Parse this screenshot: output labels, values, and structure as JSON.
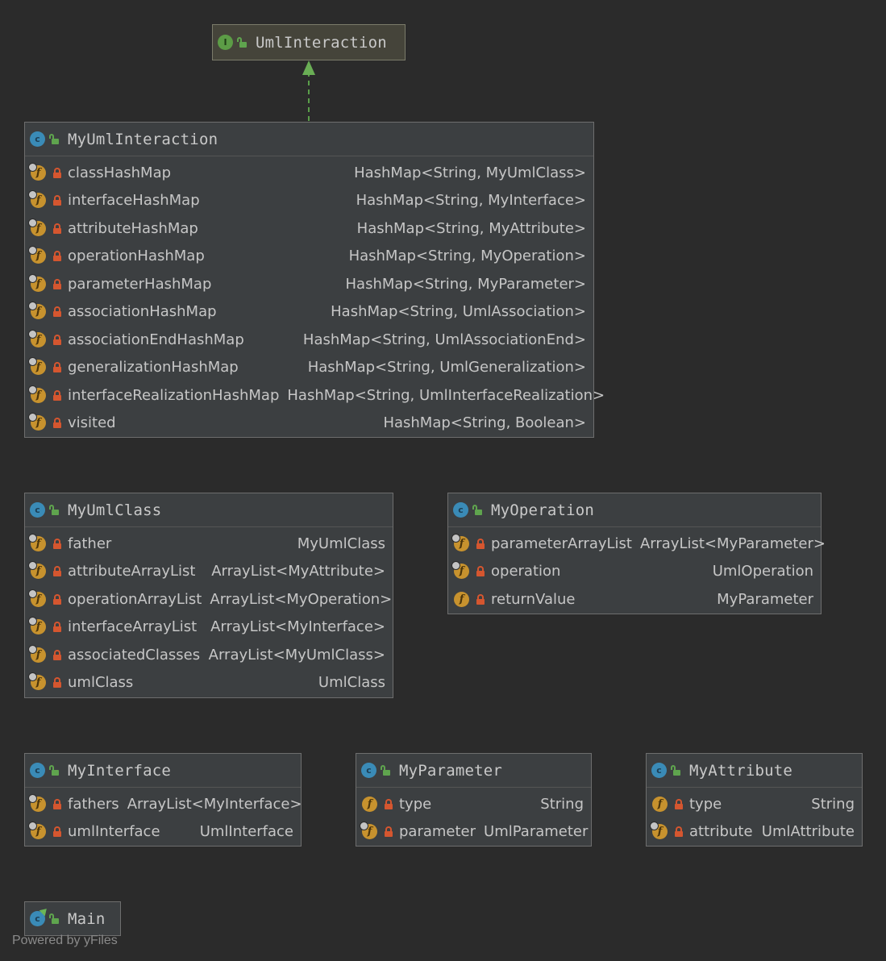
{
  "classes": [
    {
      "id": "UmlInteraction",
      "kind": "interface",
      "name": "UmlInteraction",
      "fields": []
    },
    {
      "id": "MyUmlInteraction",
      "kind": "class",
      "name": "MyUmlInteraction",
      "fields": [
        {
          "name": "classHashMap",
          "type": "HashMap<String, MyUmlClass>"
        },
        {
          "name": "interfaceHashMap",
          "type": "HashMap<String, MyInterface>"
        },
        {
          "name": "attributeHashMap",
          "type": "HashMap<String, MyAttribute>"
        },
        {
          "name": "operationHashMap",
          "type": "HashMap<String, MyOperation>"
        },
        {
          "name": "parameterHashMap",
          "type": "HashMap<String, MyParameter>"
        },
        {
          "name": "associationHashMap",
          "type": "HashMap<String, UmlAssociation>"
        },
        {
          "name": "associationEndHashMap",
          "type": "HashMap<String, UmlAssociationEnd>"
        },
        {
          "name": "generalizationHashMap",
          "type": "HashMap<String, UmlGeneralization>"
        },
        {
          "name": "interfaceRealizationHashMap",
          "type": "HashMap<String, UmlInterfaceRealization>"
        },
        {
          "name": "visited",
          "type": "HashMap<String, Boolean>"
        }
      ]
    },
    {
      "id": "MyUmlClass",
      "kind": "class",
      "name": "MyUmlClass",
      "fields": [
        {
          "name": "father",
          "type": "MyUmlClass"
        },
        {
          "name": "attributeArrayList",
          "type": "ArrayList<MyAttribute>"
        },
        {
          "name": "operationArrayList",
          "type": "ArrayList<MyOperation>"
        },
        {
          "name": "interfaceArrayList",
          "type": "ArrayList<MyInterface>"
        },
        {
          "name": "associatedClasses",
          "type": "ArrayList<MyUmlClass>"
        },
        {
          "name": "umlClass",
          "type": "UmlClass"
        }
      ]
    },
    {
      "id": "MyOperation",
      "kind": "class",
      "name": "MyOperation",
      "fields": [
        {
          "name": "parameterArrayList",
          "type": "ArrayList<MyParameter>"
        },
        {
          "name": "operation",
          "type": "UmlOperation"
        },
        {
          "name": "returnValue",
          "type": "MyParameter"
        }
      ]
    },
    {
      "id": "MyInterface",
      "kind": "class",
      "name": "MyInterface",
      "fields": [
        {
          "name": "fathers",
          "type": "ArrayList<MyInterface>"
        },
        {
          "name": "umlInterface",
          "type": "UmlInterface"
        }
      ]
    },
    {
      "id": "MyParameter",
      "kind": "class",
      "name": "MyParameter",
      "fields": [
        {
          "name": "type",
          "type": "String"
        },
        {
          "name": "parameter",
          "type": "UmlParameter"
        }
      ]
    },
    {
      "id": "MyAttribute",
      "kind": "class",
      "name": "MyAttribute",
      "fields": [
        {
          "name": "type",
          "type": "String"
        },
        {
          "name": "attribute",
          "type": "UmlAttribute"
        }
      ]
    },
    {
      "id": "Main",
      "kind": "main",
      "name": "Main",
      "fields": []
    }
  ],
  "edges": [
    {
      "from": "MyUmlInteraction",
      "to": "UmlInteraction",
      "type": "realization",
      "color": "#5a9e4a"
    }
  ],
  "footer": "Powered by yFiles",
  "colors": {
    "background": "#2b2b2b",
    "node_fill": "#3c3f41",
    "interface_fill": "#45443a",
    "class_badge": "#3a8bb7",
    "interface_badge": "#5c9c46",
    "field_badge": "#c7922e",
    "private_lock": "#d5562f",
    "public_unlock": "#5fa44e"
  }
}
